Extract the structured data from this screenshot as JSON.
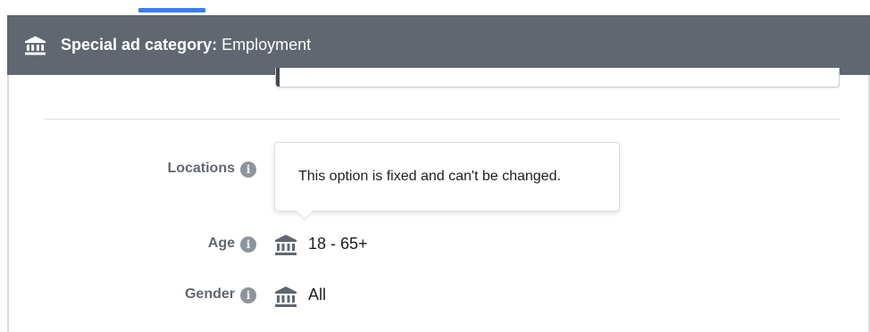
{
  "banner": {
    "label": "Special ad category:",
    "value": " Employment",
    "icon": "bank-icon"
  },
  "tooltip": {
    "text": "This option is fixed and can't be changed."
  },
  "rows": [
    {
      "label": "Locations",
      "value": "",
      "icon": "info-icon"
    },
    {
      "label": "Age",
      "value": "18 - 65+",
      "icon": "info-icon",
      "value_icon": "bank-icon"
    },
    {
      "label": "Gender",
      "value": "All",
      "icon": "info-icon",
      "value_icon": "bank-icon"
    }
  ],
  "colors": {
    "banner_bg": "#606770",
    "tab_indicator": "#3b7cf5",
    "label_text": "#606770",
    "info_icon": "#8d949e"
  }
}
